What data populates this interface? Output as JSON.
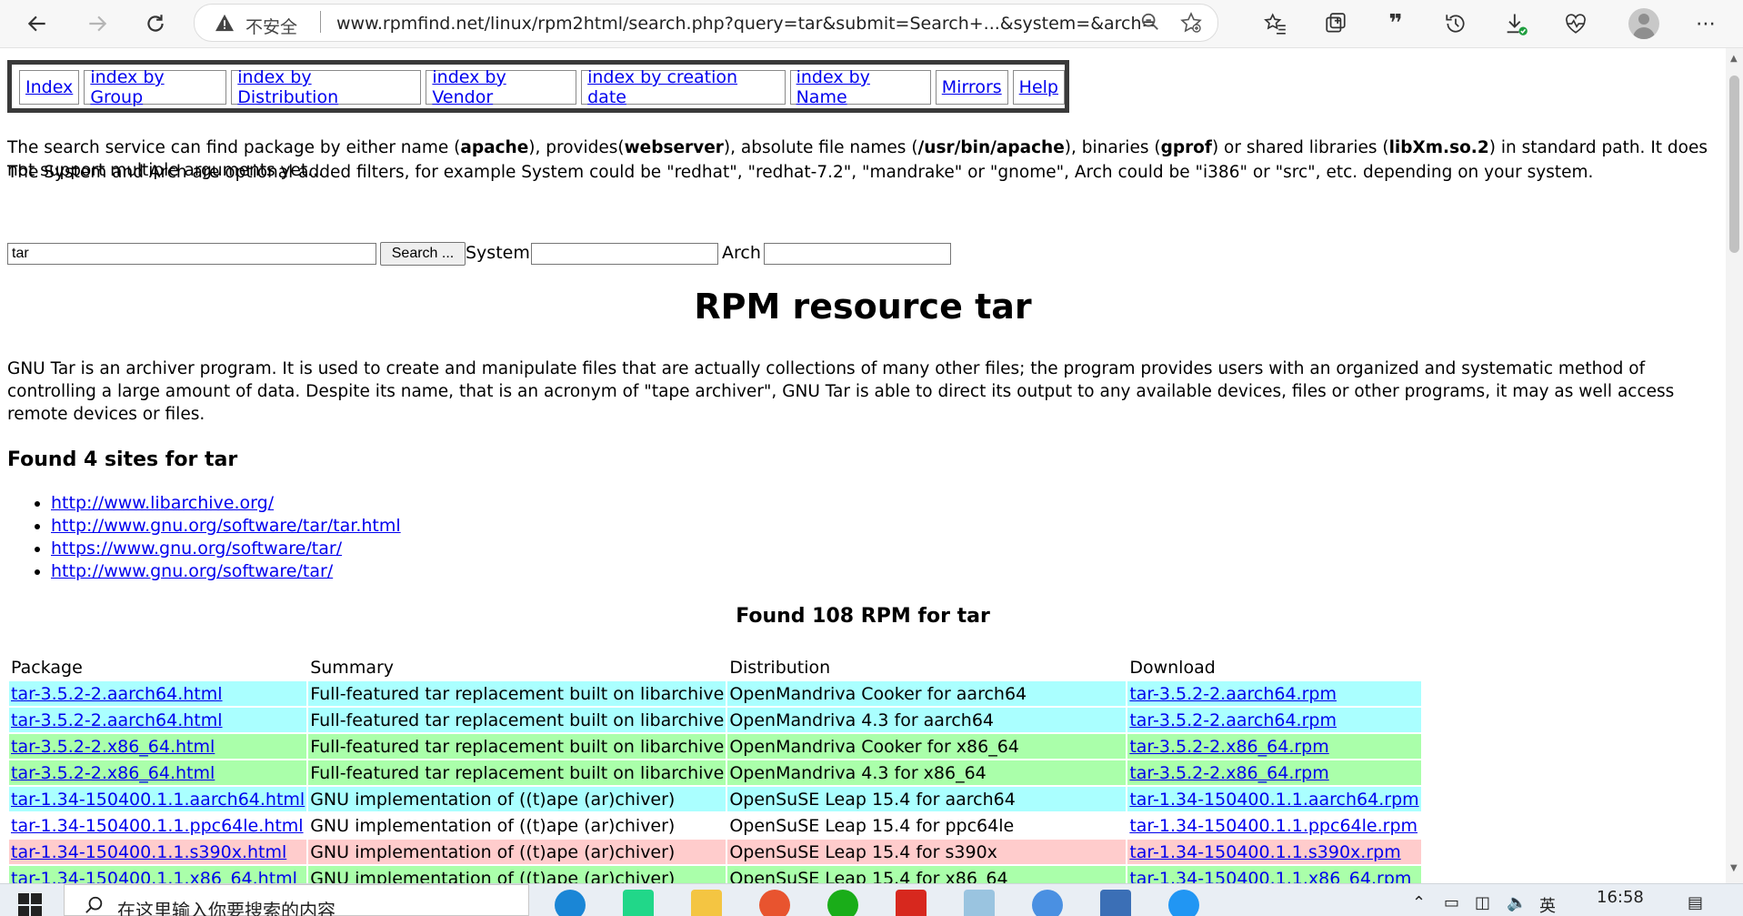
{
  "browser": {
    "insecure_label": "不安全",
    "url": "www.rpmfind.net/linux/rpm2html/search.php?query=tar&submit=Search+...&system=&arch="
  },
  "nav": {
    "links": [
      "Index",
      "index by Group",
      "index by Distribution",
      "index by Vendor",
      "index by creation date",
      "index by Name",
      "Mirrors",
      "Help"
    ]
  },
  "intro": {
    "p1": [
      {
        "t": "The search service can find package by either name (",
        "b": false
      },
      {
        "t": "apache",
        "b": true
      },
      {
        "t": "), provides(",
        "b": false
      },
      {
        "t": "webserver",
        "b": true
      },
      {
        "t": "), absolute file names (",
        "b": false
      },
      {
        "t": "/usr/bin/apache",
        "b": true
      },
      {
        "t": "), binaries (",
        "b": false
      },
      {
        "t": "gprof",
        "b": true
      },
      {
        "t": ") or shared libraries (",
        "b": false
      },
      {
        "t": "libXm.so.2",
        "b": true
      },
      {
        "t": ") in standard path. It does not support multiple arguments yet...",
        "b": false
      }
    ],
    "p2": "The System and Arch are optional added filters, for example System could be \"redhat\", \"redhat-7.2\", \"mandrake\" or \"gnome\", Arch could be \"i386\" or \"src\", etc. depending on your system."
  },
  "search": {
    "query_value": "tar",
    "button_label": "Search ...",
    "system_label": "System",
    "system_value": "",
    "arch_label": "Arch",
    "arch_value": ""
  },
  "resource": {
    "title": "RPM resource tar",
    "description": "GNU Tar is an archiver program. It is used to create and manipulate files that are actually collections of many other files; the program provides users with an organized and systematic method of controlling a large amount of data. Despite its name, that is an acronym of \"tape archiver\", GNU Tar is able to direct its output to any available devices, files or other programs, it may as well access remote devices or files."
  },
  "sites": {
    "heading": "Found 4 sites for tar",
    "links": [
      "http://www.libarchive.org/",
      "http://www.gnu.org/software/tar/tar.html",
      "https://www.gnu.org/software/tar/",
      "http://www.gnu.org/software/tar/"
    ]
  },
  "rpms": {
    "heading": "Found 108 RPM for tar",
    "headers": [
      "Package",
      "Summary",
      "Distribution",
      "Download"
    ],
    "rows": [
      {
        "package": "tar-3.5.2-2.aarch64.html",
        "summary": "Full-featured tar replacement built on libarchive",
        "distribution": "OpenMandriva Cooker for aarch64",
        "download": "tar-3.5.2-2.aarch64.rpm",
        "color": "#aaffff"
      },
      {
        "package": "tar-3.5.2-2.aarch64.html",
        "summary": "Full-featured tar replacement built on libarchive",
        "distribution": "OpenMandriva 4.3 for aarch64",
        "download": "tar-3.5.2-2.aarch64.rpm",
        "color": "#aaffff"
      },
      {
        "package": "tar-3.5.2-2.x86_64.html",
        "summary": "Full-featured tar replacement built on libarchive",
        "distribution": "OpenMandriva Cooker for x86_64",
        "download": "tar-3.5.2-2.x86_64.rpm",
        "color": "#aaffaa"
      },
      {
        "package": "tar-3.5.2-2.x86_64.html",
        "summary": "Full-featured tar replacement built on libarchive",
        "distribution": "OpenMandriva 4.3 for x86_64",
        "download": "tar-3.5.2-2.x86_64.rpm",
        "color": "#aaffaa"
      },
      {
        "package": "tar-1.34-150400.1.1.aarch64.html",
        "summary": "GNU implementation of ((t)ape (ar)chiver)",
        "distribution": "OpenSuSE Leap 15.4 for aarch64",
        "download": "tar-1.34-150400.1.1.aarch64.rpm",
        "color": "#aaffff"
      },
      {
        "package": "tar-1.34-150400.1.1.ppc64le.html",
        "summary": "GNU implementation of ((t)ape (ar)chiver)",
        "distribution": "OpenSuSE Leap 15.4 for ppc64le",
        "download": "tar-1.34-150400.1.1.ppc64le.rpm",
        "color": "#ffffff"
      },
      {
        "package": "tar-1.34-150400.1.1.s390x.html",
        "summary": "GNU implementation of ((t)ape (ar)chiver)",
        "distribution": "OpenSuSE Leap 15.4 for s390x",
        "download": "tar-1.34-150400.1.1.s390x.rpm",
        "color": "#ffcccc"
      },
      {
        "package": "tar-1.34-150400.1.1.x86_64.html",
        "summary": "GNU implementation of ((t)ape (ar)chiver)",
        "distribution": "OpenSuSE Leap 15.4 for x86_64",
        "download": "tar-1.34-150400.1.1.x86_64.rpm",
        "color": "#aaffaa"
      }
    ]
  },
  "taskbar": {
    "search_placeholder": "在这里输入你要搜索的内容",
    "ime": "英",
    "clock": "16:58"
  }
}
